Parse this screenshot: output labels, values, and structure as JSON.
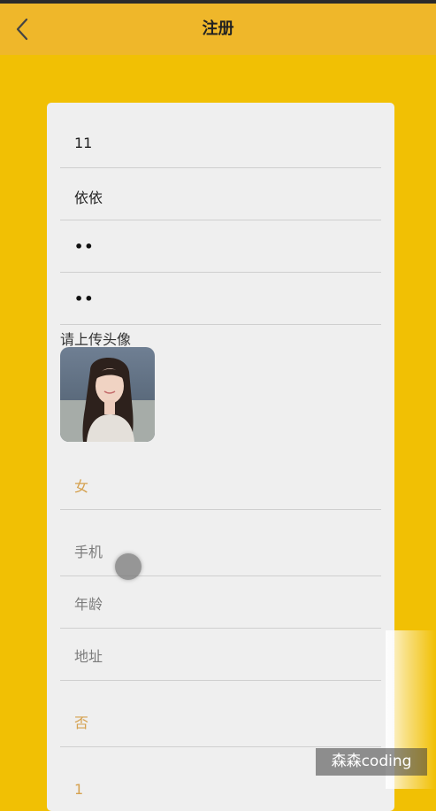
{
  "header": {
    "title": "注册",
    "back_icon": "chevron-left-icon"
  },
  "form": {
    "account": "11",
    "nickname": "依依",
    "password": "••",
    "confirm_password": "••",
    "avatar_label": "请上传头像",
    "gender": "女",
    "phone_placeholder": "手机",
    "age_placeholder": "年龄",
    "address_placeholder": "地址",
    "option": "否",
    "extra": "1"
  },
  "watermark": "森森coding",
  "colors": {
    "background": "#f1c004",
    "header": "#efb72a",
    "card": "#efefef",
    "gold_text": "#d5a14f"
  }
}
